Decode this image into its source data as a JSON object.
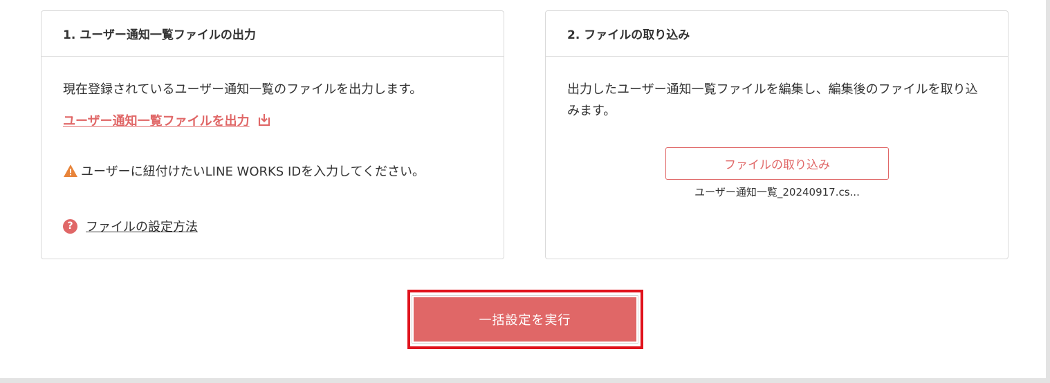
{
  "export_card": {
    "title": "1. ユーザー通知一覧ファイルの出力",
    "description": "現在登録されているユーザー通知一覧のファイルを出力します。",
    "export_link": "ユーザー通知一覧ファイルを出力",
    "warning": "ユーザーに紐付けたいLINE WORKS IDを入力してください。",
    "help_link": "ファイルの設定方法"
  },
  "import_card": {
    "title": "2. ファイルの取り込み",
    "description": "出力したユーザー通知一覧ファイルを編集し、編集後のファイルを取り込みます。",
    "import_button": "ファイルの取り込み",
    "file_name": "ユーザー通知一覧_20240917.cs..."
  },
  "actions": {
    "execute_button": "一括設定を実行"
  },
  "icons": {
    "download": "download-icon",
    "warning": "warning-triangle-icon",
    "help": "question-circle-icon"
  },
  "colors": {
    "accent": "#e06767",
    "warning": "#e8843a",
    "highlight": "#e0121c"
  }
}
